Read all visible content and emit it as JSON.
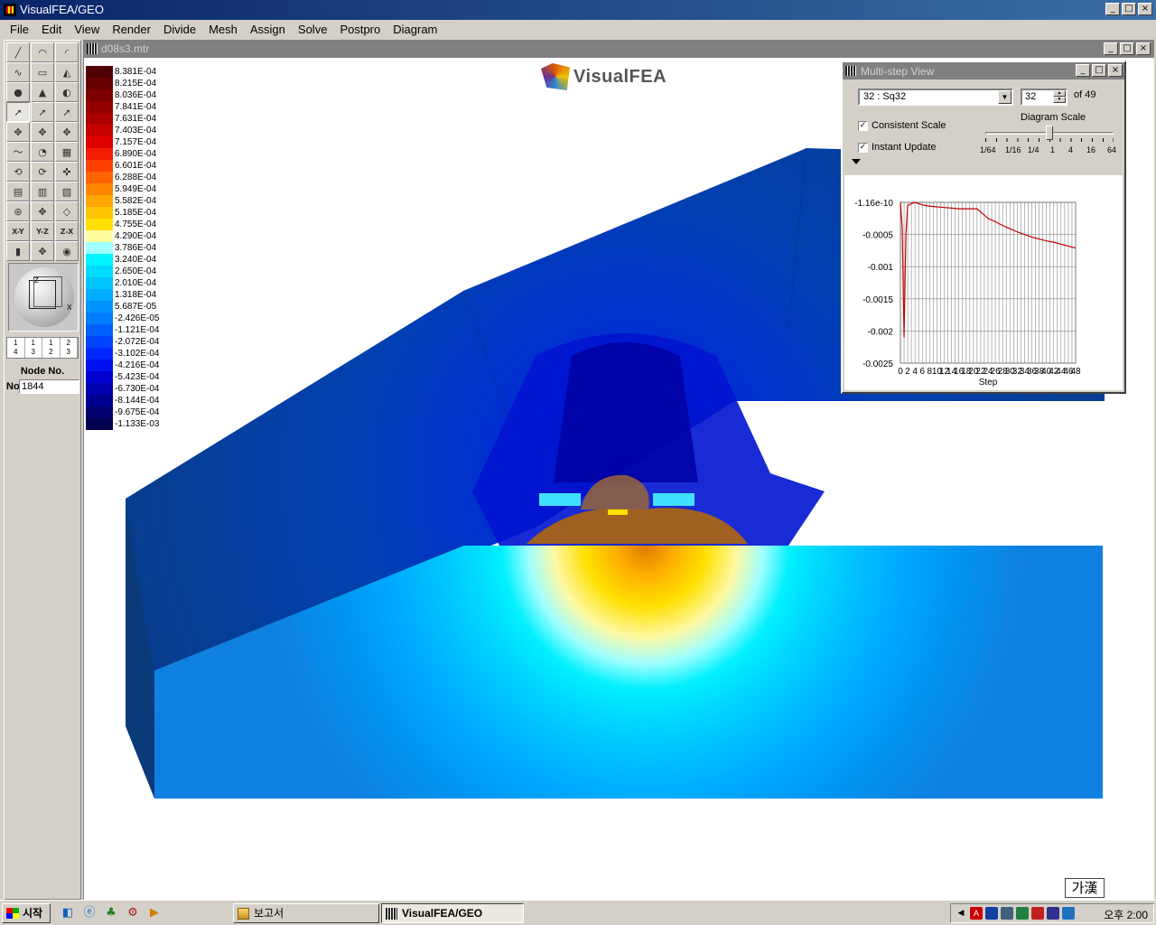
{
  "app": {
    "title": "VisualFEA/GEO"
  },
  "menu": [
    "File",
    "Edit",
    "View",
    "Render",
    "Divide",
    "Mesh",
    "Assign",
    "Solve",
    "Postpro",
    "Diagram"
  ],
  "toolbox": {
    "axis_buttons": [
      "X-Y",
      "Y-Z",
      "Z-X"
    ],
    "layer_tabs": [
      [
        "1",
        "4"
      ],
      [
        "1",
        "3"
      ],
      [
        "1",
        "2"
      ],
      [
        "2",
        "3"
      ]
    ],
    "orient_axes": {
      "z": "Z",
      "x": "X"
    },
    "node_label": "Node No.",
    "node_prefix": "No",
    "node_value": "1844"
  },
  "document": {
    "title": "d08s3.mtr",
    "logo_text": "VisualFEA"
  },
  "legend": [
    {
      "label": "8.381E-04",
      "color": "#500000"
    },
    {
      "label": "8.215E-04",
      "color": "#660000"
    },
    {
      "label": "8.036E-04",
      "color": "#7c0000"
    },
    {
      "label": "7.841E-04",
      "color": "#940000"
    },
    {
      "label": "7.631E-04",
      "color": "#ac0000"
    },
    {
      "label": "7.403E-04",
      "color": "#c60000"
    },
    {
      "label": "7.157E-04",
      "color": "#e00000"
    },
    {
      "label": "6.890E-04",
      "color": "#f41c00"
    },
    {
      "label": "6.601E-04",
      "color": "#ff4000"
    },
    {
      "label": "6.288E-04",
      "color": "#ff6400"
    },
    {
      "label": "5.949E-04",
      "color": "#ff8600"
    },
    {
      "label": "5.582E-04",
      "color": "#ffa600"
    },
    {
      "label": "5.185E-04",
      "color": "#ffc400"
    },
    {
      "label": "4.755E-04",
      "color": "#ffe000"
    },
    {
      "label": "4.290E-04",
      "color": "#fffca0"
    },
    {
      "label": "3.786E-04",
      "color": "#a0ffff"
    },
    {
      "label": "3.240E-04",
      "color": "#00f4ff"
    },
    {
      "label": "2.650E-04",
      "color": "#00dcff"
    },
    {
      "label": "2.010E-04",
      "color": "#00c4ff"
    },
    {
      "label": "1.318E-04",
      "color": "#00acff"
    },
    {
      "label": "5.687E-05",
      "color": "#0094ff"
    },
    {
      "label": "-2.426E-05",
      "color": "#007cff"
    },
    {
      "label": "-1.121E-04",
      "color": "#0060ff"
    },
    {
      "label": "-2.072E-04",
      "color": "#0044ff"
    },
    {
      "label": "-3.102E-04",
      "color": "#0028ff"
    },
    {
      "label": "-4.216E-04",
      "color": "#0010ee"
    },
    {
      "label": "-5.423E-04",
      "color": "#0000d0"
    },
    {
      "label": "-6.730E-04",
      "color": "#0000b0"
    },
    {
      "label": "-8.144E-04",
      "color": "#000090"
    },
    {
      "label": "-9.675E-04",
      "color": "#000070"
    },
    {
      "label": "-1.133E-03",
      "color": "#000050"
    }
  ],
  "multistep": {
    "title": "Multi-step View",
    "step_select": "32 : Sq32",
    "step_value": "32",
    "of_text": "of 49",
    "consistent_scale": "Consistent Scale",
    "instant_update": "Instant Update",
    "diagram_scale_title": "Diagram Scale",
    "scale_labels": [
      "1/64",
      "1/16",
      "1/4",
      "1",
      "4",
      "16",
      "64"
    ],
    "scale_value": "1"
  },
  "chart_data": {
    "type": "line",
    "title": "",
    "xlabel": "Step",
    "ylabel": "",
    "xlim": [
      0,
      48
    ],
    "ylim": [
      -0.0025,
      0
    ],
    "y_tick_labels": [
      "-1.16e-10",
      "-0.0005",
      "-0.001",
      "-0.0015",
      "-0.002",
      "-0.0025"
    ],
    "y_ticks": [
      0,
      -0.0005,
      -0.001,
      -0.0015,
      -0.002,
      -0.0025
    ],
    "x_tick_labels": [
      "0",
      "2",
      "4",
      "6",
      "8",
      "10",
      "12",
      "14",
      "16",
      "18",
      "20",
      "22",
      "24",
      "26",
      "28",
      "30",
      "32",
      "34",
      "36",
      "38",
      "40",
      "42",
      "44",
      "46",
      "48"
    ],
    "grid": true,
    "series": [
      {
        "color": "#c00000",
        "x": [
          0,
          0.5,
          1,
          1.5,
          2,
          3,
          4,
          6,
          8,
          10,
          12,
          14,
          16,
          18,
          20,
          21,
          22,
          24,
          26,
          28,
          30,
          32,
          34,
          36,
          38,
          40,
          42,
          44,
          46,
          48
        ],
        "y": [
          0,
          -0.0004,
          -0.0021,
          -0.0005,
          -5e-05,
          -2e-05,
          0,
          -4e-05,
          -6e-05,
          -7e-05,
          -8e-05,
          -9e-05,
          -0.0001,
          -0.0001,
          -0.0001,
          -0.0001,
          -0.00015,
          -0.00025,
          -0.0003,
          -0.00036,
          -0.00041,
          -0.00046,
          -0.0005,
          -0.00054,
          -0.00057,
          -0.0006,
          -0.00062,
          -0.00065,
          -0.00068,
          -0.00071
        ]
      }
    ]
  },
  "ime": "가漢",
  "taskbar": {
    "start": "시작",
    "tasks": [
      "보고서",
      "VisualFEA/GEO"
    ],
    "clock": "오후 2:00"
  }
}
